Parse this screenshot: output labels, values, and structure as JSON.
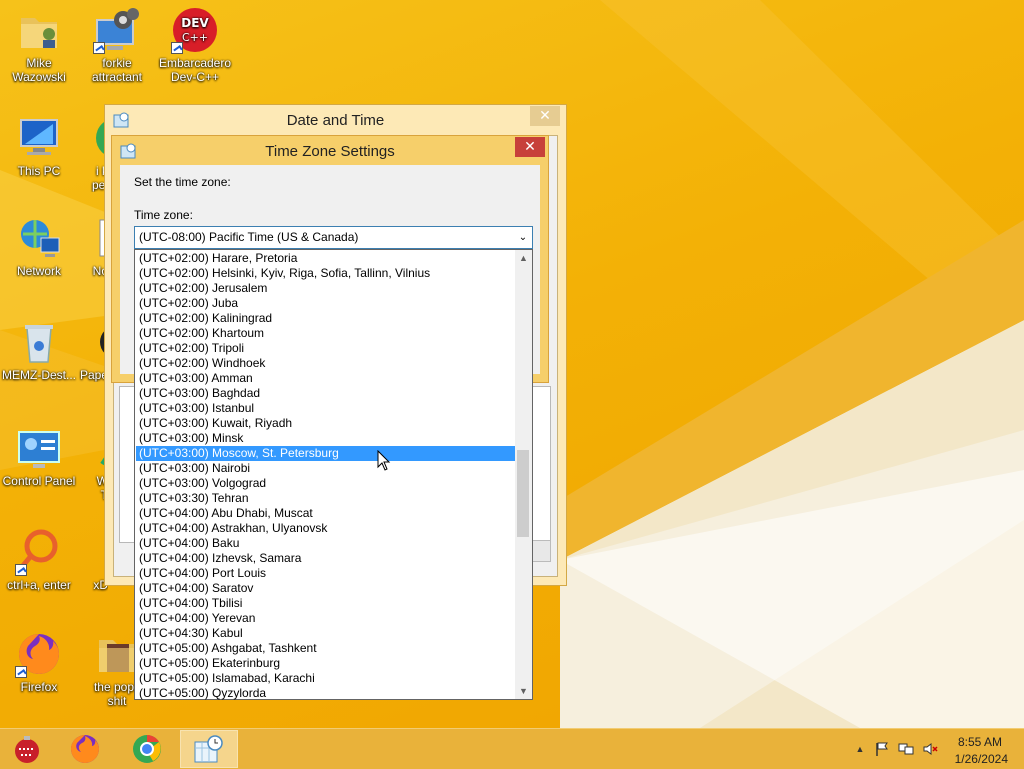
{
  "desktop": {
    "icons": [
      {
        "label": "Mike\nWazowski",
        "icon": "user-folder-icon"
      },
      {
        "label": "forkie\nattractant",
        "icon": "settings-pc-icon"
      },
      {
        "label": "Embarcadero\nDev-C++",
        "icon": "devcpp-icon"
      },
      {
        "label": "This PC",
        "icon": "computer-icon"
      },
      {
        "label": "i kr\npeo",
        "icon": "chrome-icon"
      },
      {
        "label": "Network",
        "icon": "network-icon"
      },
      {
        "label": "No",
        "icon": "notepad-icon"
      },
      {
        "label": "MEMZ-Dest...",
        "icon": "recycle-bin-icon"
      },
      {
        "label": "Pape",
        "icon": "paper-icon"
      },
      {
        "label": "Control Panel",
        "icon": "control-panel-icon"
      },
      {
        "label": "W\nT",
        "icon": "app-icon"
      },
      {
        "label": "ctrl+a, enter",
        "icon": "magnifier-icon"
      },
      {
        "label": "xD",
        "icon": "app-icon"
      },
      {
        "label": "Firefox",
        "icon": "firefox-icon"
      },
      {
        "label": "the popc\nshit",
        "icon": "folder-icon"
      }
    ]
  },
  "date_time_window": {
    "title": "Date and Time",
    "close_label": "✕"
  },
  "time_zone_window": {
    "title": "Time Zone Settings",
    "close_label": "✕",
    "prompt": "Set the time zone:",
    "field_label": "Time zone:",
    "selected_value": "(UTC-08:00) Pacific Time (US & Canada)",
    "dropdown_arrow": "⌄",
    "options": [
      "(UTC+02:00) Harare, Pretoria",
      "(UTC+02:00) Helsinki, Kyiv, Riga, Sofia, Tallinn, Vilnius",
      "(UTC+02:00) Jerusalem",
      "(UTC+02:00) Juba",
      "(UTC+02:00) Kaliningrad",
      "(UTC+02:00) Khartoum",
      "(UTC+02:00) Tripoli",
      "(UTC+02:00) Windhoek",
      "(UTC+03:00) Amman",
      "(UTC+03:00) Baghdad",
      "(UTC+03:00) Istanbul",
      "(UTC+03:00) Kuwait, Riyadh",
      "(UTC+03:00) Minsk",
      "(UTC+03:00) Moscow, St. Petersburg",
      "(UTC+03:00) Nairobi",
      "(UTC+03:00) Volgograd",
      "(UTC+03:30) Tehran",
      "(UTC+04:00) Abu Dhabi, Muscat",
      "(UTC+04:00) Astrakhan, Ulyanovsk",
      "(UTC+04:00) Baku",
      "(UTC+04:00) Izhevsk, Samara",
      "(UTC+04:00) Port Louis",
      "(UTC+04:00) Saratov",
      "(UTC+04:00) Tbilisi",
      "(UTC+04:00) Yerevan",
      "(UTC+04:30) Kabul",
      "(UTC+05:00) Ashgabat, Tashkent",
      "(UTC+05:00) Ekaterinburg",
      "(UTC+05:00) Islamabad, Karachi",
      "(UTC+05:00) Qyzylorda"
    ],
    "highlighted_option": "(UTC+03:00) Moscow, St. Petersburg",
    "scroll_up": "▲",
    "scroll_down": "▼"
  },
  "taskbar": {
    "pinned": [
      "ornament-icon",
      "firefox-icon",
      "chrome-icon",
      "date-time-icon"
    ],
    "tray": [
      "chevron-up-icon",
      "flag-icon",
      "network-icon",
      "speaker-muted-icon"
    ],
    "tray_chevron": "▲",
    "time": "8:55 AM",
    "date": "1/26/2024"
  },
  "colors": {
    "accent": "#3399ff",
    "tz_close": "#c7403a",
    "taskbar": "#e9b23a"
  }
}
